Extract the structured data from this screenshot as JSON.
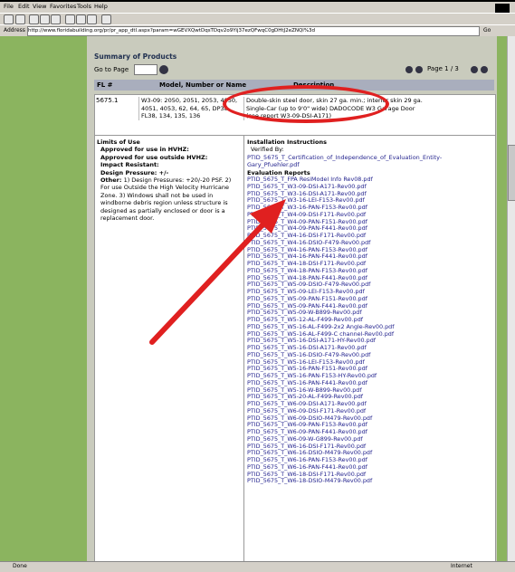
{
  "menu": [
    "File",
    "Edit",
    "View",
    "Favorites",
    "Tools",
    "Help"
  ],
  "address": {
    "label": "Address",
    "url": "http://www.floridabuilding.org/pr/pr_app_dtl.aspx?param=wGEVXQwtDqsTDqv2o9Yij37ezQFwqC0gDHtJ2eZNQl%3d",
    "go": "Go"
  },
  "summary": {
    "title": "Summary of Products",
    "goto_label": "Go to Page",
    "page_text": "Page 1 / 3",
    "headers": {
      "fl": "FL #",
      "model": "Model, Number or Name",
      "desc": "Description"
    }
  },
  "product": {
    "fl": "5675.1",
    "model": "W3-09: 2050, 2051, 2053, 4050, 4051, 4053, 62, 64, 65, DP38, FL38, 134, 135, 136",
    "desc_lines": [
      "Double-skin steel door, skin 27 ga. min.; interior skin 29 ga.",
      "Single-Car (up to 9'0\" wide) DADOCODE W3 Garage Door",
      "(see report W3-09-DSI-A171)"
    ]
  },
  "limits": {
    "title": "Limits of Use",
    "hvhz": "Approved for use in HVHZ:",
    "outside": "Approved for use outside HVHZ:",
    "impact": "Impact Resistant:",
    "pressure": "Design Pressure: +/-",
    "other_label": "Other:",
    "other_text": "1) Design Pressures: +20/-20 PSF. 2) For use Outside the High Velocity Hurricane Zone. 3) Windows shall not be used in windborne debris region unless structure is designed as partially enclosed or door is a replacement door."
  },
  "install": {
    "title": "Installation Instructions",
    "verified": "Verified By:",
    "cert": "PTID_5675_T_Certification_of_Independence_of_Evaluation_Entity-Gary_Pfuehler.pdf",
    "eval_title": "Evaluation Reports",
    "reports": [
      "PTID_5675_T_FPA ResiModel Info Rev08.pdf",
      "PTID_5675_T_W3-09-DSI-A171-Rev00.pdf",
      "PTID_5675_T_W3-16-DSI-A171-Rev00.pdf",
      "PTID_5675_T_W3-16-LEI-F153-Rev00.pdf",
      "PTID_5675_T_W3-16-PAN-F153-Rev00.pdf",
      "PTID_5675_T_W4-09-DSI-F171-Rev00.pdf",
      "PTID_5675_T_W4-09-PAN-F151-Rev00.pdf",
      "PTID_5675_T_W4-09-PAN-F441-Rev00.pdf",
      "PTID_5675_T_W4-16-DSI-F171-Rev00.pdf",
      "PTID_5675_T_W4-16-DSIO-F479-Rev00.pdf",
      "PTID_5675_T_W4-16-PAN-F153-Rev00.pdf",
      "PTID_5675_T_W4-16-PAN-F441-Rev00.pdf",
      "PTID_5675_T_W4-18-DSI-F171-Rev00.pdf",
      "PTID_5675_T_W4-18-PAN-F153-Rev00.pdf",
      "PTID_5675_T_W4-18-PAN-F441-Rev00.pdf",
      "PTID_5675_T_W5-09-DSIO-F479-Rev00.pdf",
      "PTID_5675_T_W5-09-LEI-F153-Rev00.pdf",
      "PTID_5675_T_W5-09-PAN-F151-Rev00.pdf",
      "PTID_5675_T_W5-09-PAN-F441-Rev00.pdf",
      "PTID_5675_T_W5-09-W-B899-Rev00.pdf",
      "PTID_5675_T_W5-12-AL-F499-Rev00.pdf",
      "PTID_5675_T_W5-16-AL-F499-2x2 Angle-Rev00.pdf",
      "PTID_5675_T_W5-16-AL-F499-C channel-Rev00.pdf",
      "PTID_5675_T_W5-16-DSI-A171-HY-Rev00.pdf",
      "PTID_5675_T_W5-16-DSI-A171-Rev00.pdf",
      "PTID_5675_T_W5-16-DSIO-F479-Rev00.pdf",
      "PTID_5675_T_W5-16-LEI-F153-Rev00.pdf",
      "PTID_5675_T_W5-16-PAN-F151-Rev00.pdf",
      "PTID_5675_T_W5-16-PAN-F153-HY-Rev00.pdf",
      "PTID_5675_T_W5-16-PAN-F441-Rev00.pdf",
      "PTID_5675_T_W5-16-W-B899-Rev00.pdf",
      "PTID_5675_T_W5-20-AL-F499-Rev00.pdf",
      "PTID_5675_T_W6-09-DSI-A171-Rev00.pdf",
      "PTID_5675_T_W6-09-DSI-F171-Rev00.pdf",
      "PTID_5675_T_W6-09-DSIO-M479-Rev00.pdf",
      "PTID_5675_T_W6-09-PAN-F153-Rev00.pdf",
      "PTID_5675_T_W6-09-PAN-F441-Rev00.pdf",
      "PTID_5675_T_W6-09-W-G899-Rev00.pdf",
      "PTID_5675_T_W6-16-DSI-F171-Rev00.pdf",
      "PTID_5675_T_W6-16-DSIO-M479-Rev00.pdf",
      "PTID_5675_T_W6-16-PAN-F153-Rev00.pdf",
      "PTID_5675_T_W6-16-PAN-F441-Rev00.pdf",
      "PTID_5675_T_W6-18-DSI-F171-Rev00.pdf",
      "PTID_5675_T_W6-18-DSIO-M479-Rev00.pdf"
    ]
  },
  "status": {
    "left": "Done",
    "right": "Internet"
  },
  "colors": {
    "green_strip": "#8bb45f",
    "page_bg": "#c9cbbd",
    "header_bg": "#a9aebd",
    "link": "#23238e",
    "annotation": "#e02020"
  }
}
